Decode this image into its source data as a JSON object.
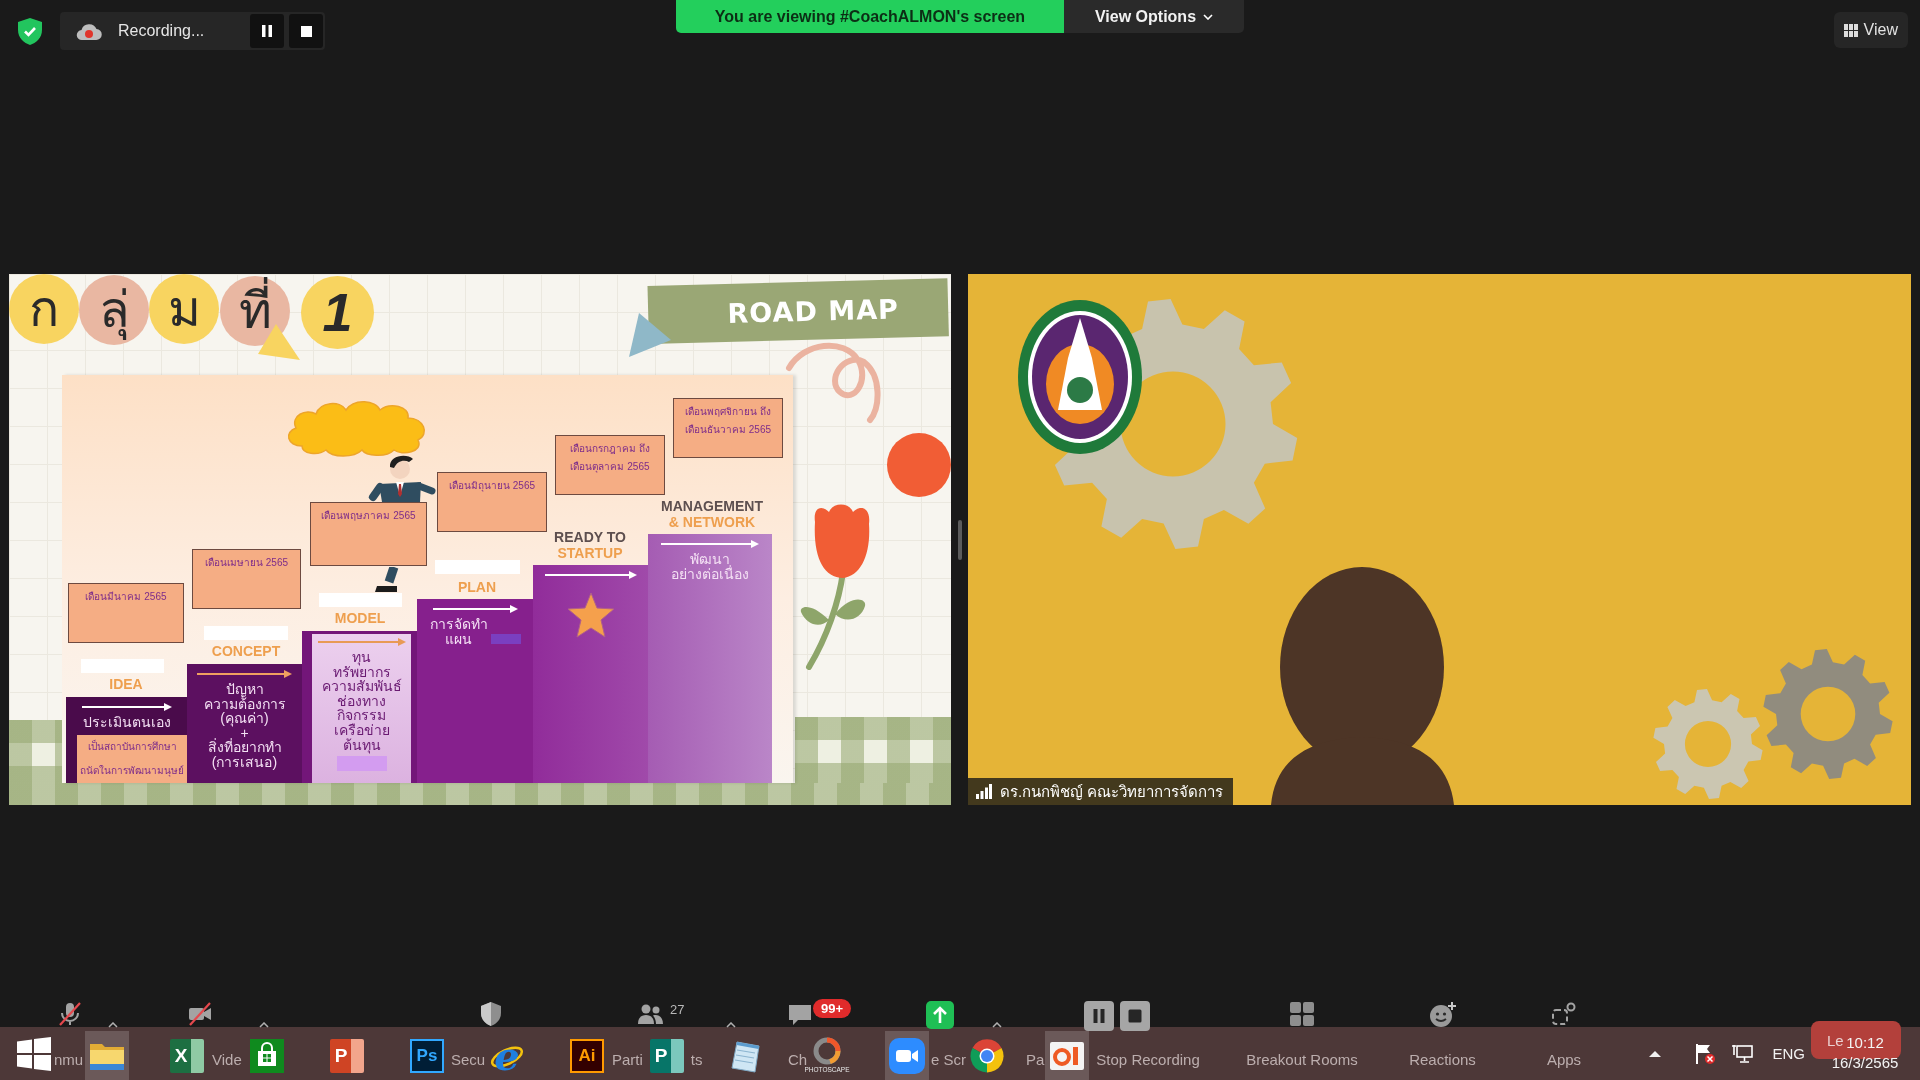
{
  "top_bar": {
    "recording": "Recording...",
    "banner": "You are viewing #CoachALMON's screen",
    "view_options": "View Options",
    "view": "View"
  },
  "slide": {
    "title": [
      "ก",
      "ลุ่",
      "ม",
      "ที่",
      "1"
    ],
    "banner": "ROAD MAP",
    "steps": [
      {
        "kind": "note",
        "month": [
          "เดือนมีนาคม 2565"
        ],
        "label": "IDEA",
        "lines": [
          "ประเมินตนเอง"
        ],
        "note": [
          "เป็นสถาบันการศึกษา",
          "ถนัดในการพัฒนามนุษย์"
        ],
        "highlight": false
      },
      {
        "kind": "text",
        "month": [
          "เดือนเมษายน 2565"
        ],
        "label": "CONCEPT",
        "lines": [
          "ปัญหา",
          "ความต้องการ",
          "(คุณค่า)",
          "+",
          "สิ่งที่อยากทำ",
          "(การเสนอ)"
        ],
        "highlight": false
      },
      {
        "kind": "panel",
        "month": [
          "เดือนพฤษภาคม 2565"
        ],
        "label": "MODEL",
        "lines": [
          "ทุน",
          "ทรัพยากร",
          "ความสัมพันธ์",
          "ช่องทาง",
          "กิจกรรม",
          "เครือข่าย",
          "ต้นทุน"
        ],
        "highlight": true
      },
      {
        "kind": "text",
        "month": [
          "เดือนมิถุนายน 2565"
        ],
        "label": "PLAN",
        "lines": [
          "การจัดทำ",
          "แผน"
        ],
        "highlight": true
      },
      {
        "kind": "star",
        "month": [
          "เดือนกรกฎาคม ถึง",
          "เดือนตุลาคม 2565"
        ],
        "heading": "READY TO",
        "label": "STARTUP",
        "highlight": false
      },
      {
        "kind": "text",
        "month": [
          "เดือนพฤศจิกายน ถึง",
          "เดือนธันวาคม 2565"
        ],
        "heading": "MANAGEMENT",
        "label": "& NETWORK",
        "lines": [
          "พัฒนา",
          "อย่างต่อเนื่อง"
        ],
        "highlight": false
      }
    ]
  },
  "video": {
    "name": "ดร.กนกพิชญ์ คณะวิทยาการจัดการ"
  },
  "toolbar": {
    "items": [
      {
        "kind": "audio",
        "label_parts": [
          "nmu"
        ],
        "off": true
      },
      {
        "kind": "video",
        "label_parts": [
          "Vide"
        ],
        "off": true
      },
      {
        "kind": "security",
        "label_parts": [
          "Secu"
        ]
      },
      {
        "kind": "participants",
        "count": "27",
        "label_parts": [
          "Parti",
          "ts"
        ]
      },
      {
        "kind": "chat",
        "badge": "99+",
        "label_parts": [
          "Ch"
        ]
      },
      {
        "kind": "share",
        "label_parts": [
          "e Scr"
        ]
      },
      {
        "kind": "record",
        "label_parts": [
          "Pa",
          "Stop Recording"
        ]
      },
      {
        "kind": "breakout",
        "label_parts": [
          "Breakout Rooms"
        ]
      },
      {
        "kind": "reactions",
        "label_parts": [
          "Reactions"
        ]
      },
      {
        "kind": "apps",
        "label_parts": [
          "Apps"
        ]
      }
    ],
    "leave": "Le"
  },
  "taskbar": {
    "apps": [
      {
        "kind": "explorer",
        "active": true
      },
      {
        "kind": "excel",
        "glyph": "X",
        "active": false
      },
      {
        "kind": "store",
        "active": false
      },
      {
        "kind": "powerpoint",
        "glyph": "P",
        "active": false
      },
      {
        "kind": "photoshop",
        "glyph": "Ps",
        "active": false
      },
      {
        "kind": "ie",
        "glyph": "e",
        "active": false
      },
      {
        "kind": "illustrator",
        "glyph": "Ai",
        "active": false
      },
      {
        "kind": "publisher",
        "glyph": "P",
        "active": false
      },
      {
        "kind": "notepad",
        "active": false
      },
      {
        "kind": "photoscape",
        "glyph": "PHOTOSCAPE",
        "active": false
      },
      {
        "kind": "zoom",
        "active": true
      },
      {
        "kind": "chrome",
        "active": false
      },
      {
        "kind": "office",
        "active": true
      }
    ],
    "language": "ENG",
    "time": "10:12",
    "date": "16/3/2565"
  }
}
